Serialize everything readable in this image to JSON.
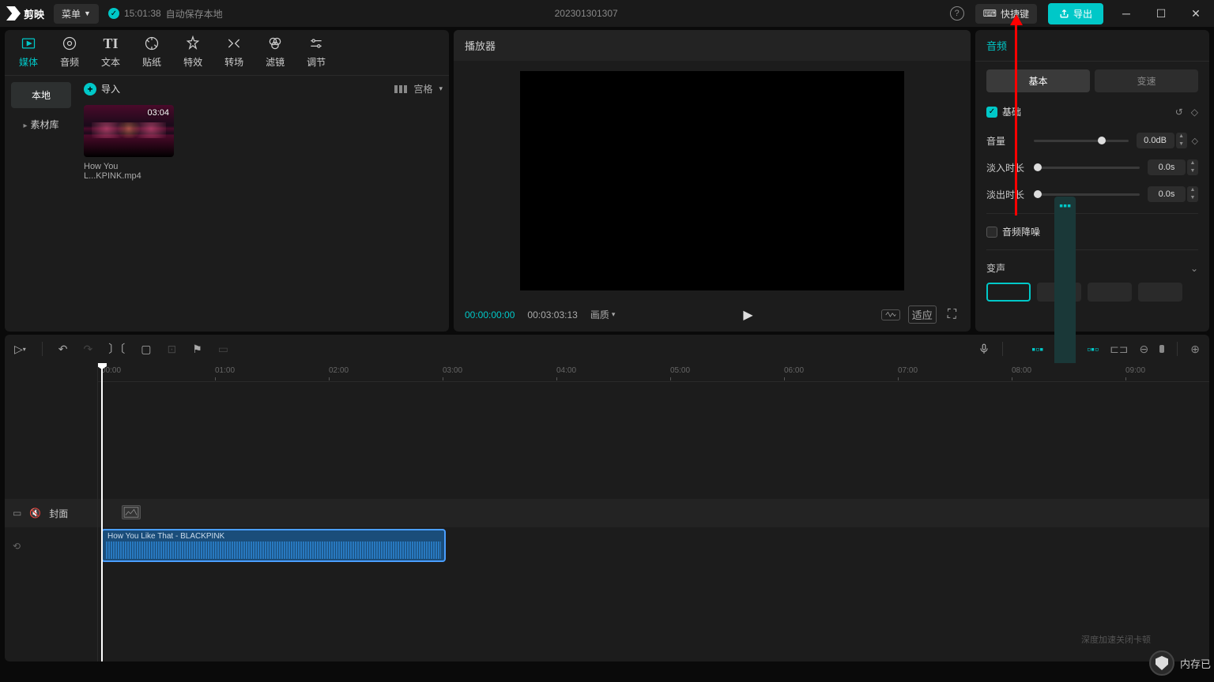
{
  "titlebar": {
    "app_name": "剪映",
    "menu_label": "菜单",
    "autosave_time": "15:01:38",
    "autosave_text": "自动保存本地",
    "project_title": "202301301307",
    "shortcut_label": "快捷键",
    "export_label": "导出"
  },
  "tabs": [
    {
      "label": "媒体",
      "icon": "media"
    },
    {
      "label": "音频",
      "icon": "audio"
    },
    {
      "label": "文本",
      "icon": "text"
    },
    {
      "label": "贴纸",
      "icon": "sticker"
    },
    {
      "label": "特效",
      "icon": "effect"
    },
    {
      "label": "转场",
      "icon": "transition"
    },
    {
      "label": "滤镜",
      "icon": "filter"
    },
    {
      "label": "调节",
      "icon": "adjust"
    }
  ],
  "sidebar": {
    "items": [
      {
        "label": "本地",
        "active": true
      },
      {
        "label": "素材库",
        "active": false
      }
    ]
  },
  "import": {
    "button_label": "导入",
    "view_label": "宫格"
  },
  "media": {
    "thumb_duration": "03:04",
    "thumb_name": "How You L...KPINK.mp4"
  },
  "preview": {
    "header": "播放器",
    "time_current": "00:00:00:00",
    "time_total": "00:03:03:13",
    "quality_label": "画质",
    "adapt_label": "适应"
  },
  "right": {
    "tab_audio": "音频",
    "subtab_basic": "基本",
    "subtab_speed": "变速",
    "section_basic": "基础",
    "volume_label": "音量",
    "volume_value": "0.0dB",
    "fadein_label": "淡入时长",
    "fadein_value": "0.0s",
    "fadeout_label": "淡出时长",
    "fadeout_value": "0.0s",
    "denoise_label": "音频降噪",
    "voice_label": "变声"
  },
  "timeline": {
    "ruler": [
      "00:00",
      "01:00",
      "02:00",
      "03:00",
      "04:00",
      "05:00",
      "06:00",
      "07:00",
      "08:00",
      "09:00"
    ],
    "cover_label": "封面",
    "audio_clip_label": "How You Like That - BLACKPINK"
  },
  "footer": {
    "mem_label": "内存已",
    "accel_text": "深度加速关闭卡顿"
  }
}
